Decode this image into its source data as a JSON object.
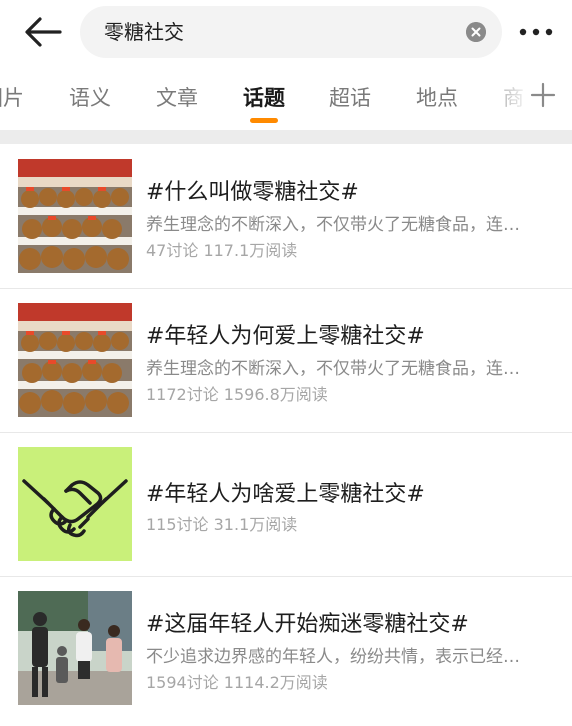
{
  "search": {
    "query": "零糖社交"
  },
  "tabs": [
    {
      "label": "图片"
    },
    {
      "label": "语义"
    },
    {
      "label": "文章"
    },
    {
      "label": "话题"
    },
    {
      "label": "超话"
    },
    {
      "label": "地点"
    },
    {
      "label": "商"
    }
  ],
  "active_tab": "话题",
  "topics": [
    {
      "title": "#什么叫做零糖社交#",
      "description": "养生理念的不断深入，不仅带火了无糖食品，连…",
      "stats": "47讨论 117.1万阅读",
      "thumbnail": "plush-toys-photo"
    },
    {
      "title": "#年轻人为何爱上零糖社交#",
      "description": "养生理念的不断深入，不仅带火了无糖食品，连…",
      "stats": "1172讨论 1596.8万阅读",
      "thumbnail": "plush-toys-photo"
    },
    {
      "title": "#年轻人为啥爱上零糖社交#",
      "description": "",
      "stats": "115讨论 31.1万阅读",
      "thumbnail": "handshake-illustration"
    },
    {
      "title": "#这届年轻人开始痴迷零糖社交#",
      "description": "不少追求边界感的年轻人，纷纷共情，表示已经…",
      "stats": "1594讨论 1114.2万阅读",
      "thumbnail": "people-outdoor-photo"
    }
  ],
  "colors": {
    "accent": "#ff8a00",
    "handshake_bg": "#c9f07a",
    "separator_band": "#ececec"
  },
  "icons": [
    "back-arrow-icon",
    "clear-icon",
    "more-icon",
    "plus-icon"
  ]
}
